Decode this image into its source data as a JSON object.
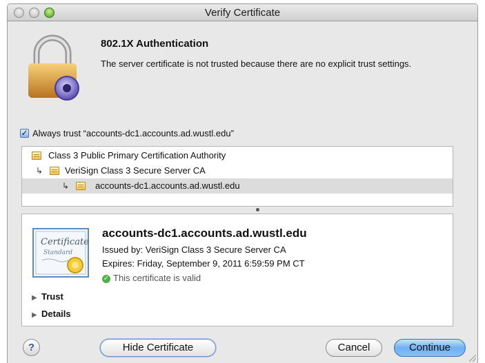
{
  "window": {
    "title": "Verify Certificate"
  },
  "header": {
    "heading": "802.1X Authentication",
    "description": "The server certificate is not trusted because there are no explicit trust settings."
  },
  "trust_option": {
    "checked": true,
    "label": "Always trust “accounts-dc1.accounts.ad.wustl.edu”"
  },
  "cert_chain": [
    {
      "label": "Class 3 Public Primary Certification Authority",
      "selected": false
    },
    {
      "label": "VeriSign Class 3 Secure Server CA",
      "selected": false
    },
    {
      "label": "accounts-dc1.accounts.ad.wustl.edu",
      "selected": true
    }
  ],
  "certificate": {
    "name": "accounts-dc1.accounts.ad.wustl.edu",
    "issued_by": "Issued by: VeriSign Class 3 Secure Server CA",
    "expires": "Expires: Friday, September 9, 2011 6:59:59 PM CT",
    "status": "This certificate is valid",
    "status_color": "#4db343",
    "badge_title": "Certificate",
    "badge_subtitle": "Standard"
  },
  "disclosures": {
    "trust": "Trust",
    "details": "Details"
  },
  "buttons": {
    "help": "?",
    "hide_certificate": "Hide Certificate",
    "cancel": "Cancel",
    "continue": "Continue"
  },
  "colors": {
    "default_button": "#6eb0f2",
    "selection": "#dcdcdc"
  }
}
